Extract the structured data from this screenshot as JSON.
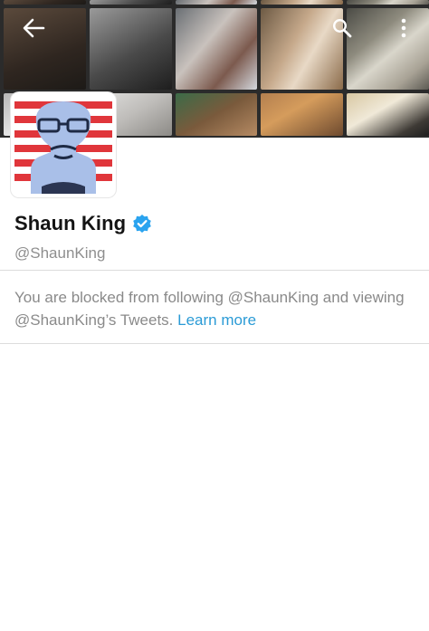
{
  "header": {
    "icons": {
      "back": "arrow-back-icon",
      "search": "search-icon",
      "more": "more-vertical-icon"
    }
  },
  "profile": {
    "name": "Shaun King",
    "handle": "@ShaunKing",
    "verified": true
  },
  "notice": {
    "text": "You are blocked from following @ShaunKing and viewing @ShaunKing’s Tweets.",
    "link_label": "Learn more"
  },
  "colors": {
    "link": "#2b9bd6",
    "verified": "#2aa3ef",
    "muted_text": "#8e8e8e"
  }
}
